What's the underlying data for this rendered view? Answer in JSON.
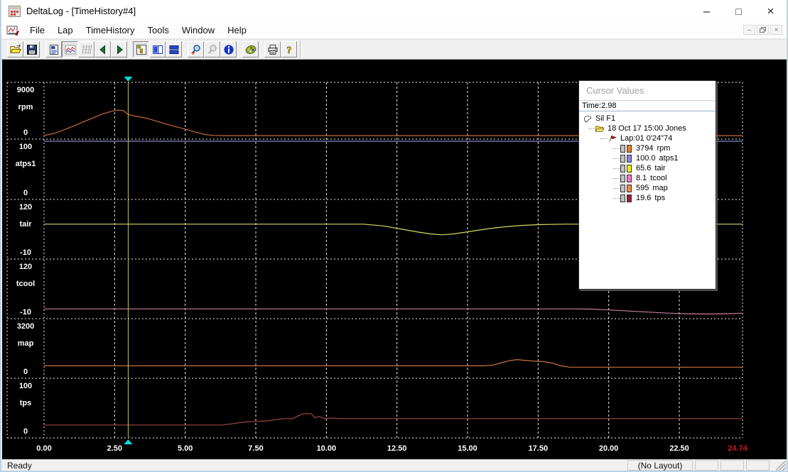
{
  "window": {
    "title": "DeltaLog - [TimeHistory#4]",
    "controls": [
      {
        "name": "minimize-button",
        "glyph": "–"
      },
      {
        "name": "maximize-button",
        "glyph": "□"
      },
      {
        "name": "close-button",
        "glyph": "×"
      }
    ],
    "mdi_controls": [
      {
        "name": "mdi-minimize-button",
        "glyph": "–"
      },
      {
        "name": "mdi-restore-button",
        "glyph": "❐"
      },
      {
        "name": "mdi-close-button",
        "glyph": "×"
      }
    ]
  },
  "menu": {
    "items": [
      "File",
      "Lap",
      "TimeHistory",
      "Tools",
      "Window",
      "Help"
    ]
  },
  "toolbar": {
    "buttons": [
      {
        "icon": "open-folder-icon",
        "state": "normal",
        "group_start": false
      },
      {
        "icon": "save-icon",
        "state": "normal",
        "group_start": false
      },
      {
        "icon": "report-icon",
        "state": "normal",
        "group_start": true
      },
      {
        "icon": "timehistory-chart-icon",
        "state": "pressed",
        "group_start": false
      },
      {
        "icon": "grid-icon",
        "state": "disabled",
        "group_start": false
      },
      {
        "icon": "prev-lap-icon",
        "state": "normal",
        "group_start": false
      },
      {
        "icon": "next-lap-icon",
        "state": "normal",
        "group_start": false
      },
      {
        "icon": "cursor-values-tree-icon",
        "state": "pressed",
        "group_start": true
      },
      {
        "icon": "split-vertical-icon",
        "state": "normal",
        "group_start": false
      },
      {
        "icon": "split-horizontal-icon",
        "state": "normal",
        "group_start": false
      },
      {
        "icon": "zoom-in-icon",
        "state": "normal",
        "group_start": true
      },
      {
        "icon": "zoom-out-icon",
        "state": "disabled",
        "group_start": false
      },
      {
        "icon": "info-icon",
        "state": "normal",
        "group_start": false
      },
      {
        "icon": "palette-icon",
        "state": "normal",
        "group_start": true
      },
      {
        "icon": "print-icon",
        "state": "normal",
        "group_start": true
      },
      {
        "icon": "help-icon",
        "state": "normal",
        "group_start": false
      }
    ]
  },
  "cursor_panel": {
    "title": "Cursor Values",
    "time_label": "Time:2.98",
    "tree": {
      "root": {
        "icon": "track-icon",
        "label": "Sil F1"
      },
      "session": {
        "icon": "folder-icon",
        "label": "18 Oct 17  15:00  Jones"
      },
      "lap": {
        "icon": "lap-flag-icon",
        "label": "Lap:01  0'24\"74"
      },
      "channels": [
        {
          "value": "3794",
          "name": "rpm",
          "color": "#e87e28"
        },
        {
          "value": "100.0",
          "name": "atps1",
          "color": "#8888d8"
        },
        {
          "value": "65.6",
          "name": "tair",
          "color": "#f0f010"
        },
        {
          "value": "8.1",
          "name": "tcool",
          "color": "#f078c8"
        },
        {
          "value": "595",
          "name": "map",
          "color": "#f08848"
        },
        {
          "value": "19.6",
          "name": "tps",
          "color": "#8e2438"
        }
      ]
    }
  },
  "status_bar": {
    "left": "Ready",
    "layout_label": "(No Layout)",
    "empty_panels": 3
  },
  "chart_data": {
    "type": "line",
    "title": "TimeHistory#4",
    "xlim": [
      0,
      24.74
    ],
    "x_tick_step": 2.5,
    "x_ticks": [
      "0.00",
      "2.50",
      "5.00",
      "7.50",
      "10.00",
      "12.50",
      "15.00",
      "17.50",
      "20.00",
      "22.50"
    ],
    "x_end_label": "24.74",
    "x_end_color": "#d01818",
    "cursor_time": 2.98,
    "cursor_color": "#c8c858",
    "cursor_marker_color": "#00dede",
    "grid_color": "#ececec",
    "background": "#000000",
    "legend_position": "floating cursor-values panel",
    "panels": [
      {
        "name": "rpm",
        "ymax_label": "9000",
        "ymin_label": "0",
        "ylim": [
          0,
          9000
        ],
        "color": "#c86a3c",
        "points": [
          [
            0,
            250
          ],
          [
            0.35,
            600
          ],
          [
            0.7,
            1200
          ],
          [
            1.05,
            1900
          ],
          [
            1.4,
            2600
          ],
          [
            1.75,
            3300
          ],
          [
            2.05,
            3900
          ],
          [
            2.35,
            4350
          ],
          [
            2.6,
            4600
          ],
          [
            2.8,
            4550
          ],
          [
            2.98,
            3850
          ],
          [
            3.2,
            3600
          ],
          [
            3.6,
            3250
          ],
          [
            4.0,
            2700
          ],
          [
            4.4,
            2100
          ],
          [
            4.8,
            1600
          ],
          [
            5.1,
            1200
          ],
          [
            5.4,
            800
          ],
          [
            5.7,
            420
          ],
          [
            6.0,
            270
          ],
          [
            6.4,
            230
          ],
          [
            24.74,
            230
          ]
        ]
      },
      {
        "name": "atps1",
        "ymax_label": "100",
        "ymin_label": "0",
        "ylim": [
          0,
          100
        ],
        "color": "#8888cc",
        "points": [
          [
            0,
            100
          ],
          [
            24.74,
            100
          ]
        ]
      },
      {
        "name": "tair",
        "ymax_label": "120",
        "ymin_label": "-10",
        "ylim": [
          -10,
          120
        ],
        "color": "#d6d667",
        "points": [
          [
            0,
            67
          ],
          [
            11.3,
            67
          ],
          [
            12.0,
            63
          ],
          [
            12.6,
            56
          ],
          [
            13.2,
            49
          ],
          [
            13.7,
            44
          ],
          [
            14.1,
            42
          ],
          [
            14.5,
            44
          ],
          [
            15.0,
            49
          ],
          [
            15.6,
            55
          ],
          [
            16.2,
            60
          ],
          [
            16.9,
            64
          ],
          [
            17.6,
            66
          ],
          [
            18.5,
            67
          ],
          [
            24.74,
            67
          ]
        ]
      },
      {
        "name": "tcool",
        "ymax_label": "120",
        "ymin_label": "-10",
        "ylim": [
          -10,
          120
        ],
        "color": "#c87d9e",
        "points": [
          [
            0,
            8
          ],
          [
            18.8,
            8
          ],
          [
            19.4,
            7.5
          ],
          [
            20.0,
            5.5
          ],
          [
            20.7,
            3
          ],
          [
            21.4,
            0.5
          ],
          [
            22.1,
            -2
          ],
          [
            22.8,
            -3.5
          ],
          [
            23.5,
            -4
          ],
          [
            24.1,
            -3.5
          ],
          [
            24.74,
            -2
          ]
        ]
      },
      {
        "name": "map",
        "ymax_label": "3200",
        "ymin_label": "0",
        "ylim": [
          0,
          3200
        ],
        "color": "#cc7040",
        "points": [
          [
            0,
            600
          ],
          [
            15.6,
            600
          ],
          [
            15.9,
            640
          ],
          [
            16.2,
            780
          ],
          [
            16.5,
            900
          ],
          [
            16.75,
            960
          ],
          [
            17.0,
            920
          ],
          [
            17.3,
            880
          ],
          [
            17.7,
            840
          ],
          [
            18.0,
            760
          ],
          [
            18.3,
            600
          ],
          [
            18.6,
            520
          ],
          [
            24.74,
            520
          ]
        ]
      },
      {
        "name": "tps",
        "ymax_label": "100",
        "ymin_label": "0",
        "ylim": [
          0,
          100
        ],
        "color": "#a04848",
        "points": [
          [
            0,
            19.5
          ],
          [
            6.3,
            19.5
          ],
          [
            6.7,
            22
          ],
          [
            7.1,
            25
          ],
          [
            7.5,
            26
          ],
          [
            7.9,
            27
          ],
          [
            8.2,
            29
          ],
          [
            8.5,
            31
          ],
          [
            8.8,
            31
          ],
          [
            9.0,
            36
          ],
          [
            9.2,
            40
          ],
          [
            9.45,
            40
          ],
          [
            9.6,
            33
          ],
          [
            9.75,
            35
          ],
          [
            9.95,
            31
          ],
          [
            10.2,
            32
          ],
          [
            10.5,
            31
          ],
          [
            24.74,
            31
          ]
        ]
      }
    ]
  }
}
